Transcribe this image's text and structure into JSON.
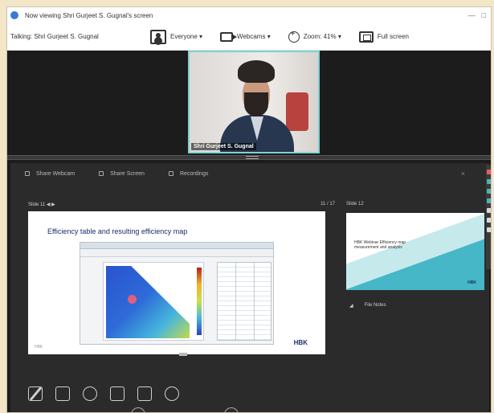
{
  "window": {
    "title": "Now viewing Shri Gurjeet S. Gugnal's screen",
    "controls": [
      "—",
      "□"
    ]
  },
  "toolbar": {
    "talking": "Talking: Shri Gurjeet S. Gugnal",
    "everyone": "Everyone ▾",
    "webcams": "Webcams ▾",
    "zoom": "Zoom: 41% ▾",
    "fullscreen": "Full screen"
  },
  "video": {
    "name": "Shri Gurjeet S. Gugnal"
  },
  "panel": {
    "tabs": [
      "Share Webcam",
      "Share Screen",
      "Recordings"
    ],
    "close": "×"
  },
  "slide": {
    "header_left": "Slide 11  ◀  ▶",
    "header_page": "11 / 17",
    "title": "Efficiency table and resulting efficiency map",
    "logo": "HBK",
    "footnote": "HBK"
  },
  "preview": {
    "head": "Slide 12",
    "thumb_text": "HBK Webinar Efficiency map measurement and analysis",
    "thumb_logo": "HBK",
    "file_label": "File Notes"
  },
  "colors": {
    "accent": "#7fd2d6",
    "stage_bg": "#1c1c1c",
    "panel_bg": "#2b2b2b",
    "brand": "#1a2c6e"
  },
  "sidebar": {
    "colors": [
      "#e36060",
      "#4fb3b8",
      "#4fb3b8",
      "#4fb3b8",
      "#d9d9d9",
      "#d9d9d9",
      "#d9d9d9"
    ]
  },
  "icons": {
    "bottom_tools": [
      "pen-icon",
      "copy-icon",
      "search-icon",
      "present-icon",
      "screen-icon",
      "more-icon"
    ]
  }
}
